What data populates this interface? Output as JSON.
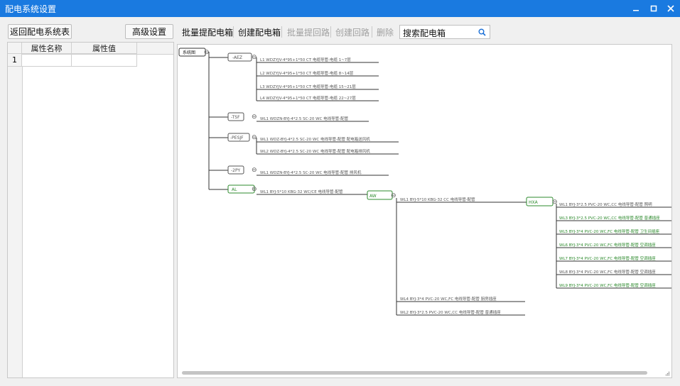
{
  "window": {
    "title": "配电系统设置"
  },
  "left": {
    "back_button": "返回配电系统表",
    "advanced_button": "高级设置",
    "grid": {
      "col1": "属性名称",
      "col2": "属性值",
      "row1_num": "1"
    }
  },
  "toolbar": {
    "batch_extract_box": "批量提配电箱",
    "create_box": "创建配电箱",
    "batch_extract_circuit": "批量提回路",
    "create_circuit": "创建回路",
    "delete": "删除",
    "search_placeholder": "搜索配电箱"
  },
  "tree": {
    "root": "系统图",
    "toggle_glyph": "⊖",
    "g1": {
      "label": "-AEZ",
      "circuits": [
        "L1  WDZYJV-4*95+1*50 CT 电缆导管-电缆  1~7层",
        "L2  WDZYJV-4*95+1*50 CT 电缆导管-电缆  8~14层",
        "L3  WDZYJV-4*95+1*50 CT 电缆导管-电缆  15~21层",
        "L4  WDZYJV-4*95+1*50 CT 电缆导管-电缆  22~27层"
      ]
    },
    "g2": {
      "label": "-TSF",
      "circuits": [
        "WL1  WDZN-BYJ-4*2.5 SC-20 WC 电线导管-配管"
      ]
    },
    "g3": {
      "label": "-PESJF",
      "circuits": [
        "WL1  WDZ-BYJ-4*2.5 SC-20 WC 电线导管-配管 配电箱送风机",
        "WL2  WDZ-BYJ-4*2.5 SC-20 WC 电线导管-配管 配电箱排风机"
      ]
    },
    "g4": {
      "label": "-2PY",
      "circuits": [
        "WL1  WDZN-BYJ-4*2.5 SC-20 WC 电线导管-配管 排风机"
      ]
    },
    "g5": {
      "label": "AL",
      "circuits": [
        "WL1  BYJ-5*10 KBG-32 WC/CE 电线导管-配管"
      ]
    },
    "aw": {
      "label": "AW",
      "circuit": "WL1  BYJ-5*10 KBG-32 CC 电线导管-配管",
      "lower_circuits": [
        "WL4  BYJ-3*4  PVC-20  WC,FC  电线导管-配管  厨房插座",
        "WL2  BYJ-3*2.5  PVC-20  WC,CC  电线导管-配管  普通插座"
      ]
    },
    "hxa": {
      "label": "HXA",
      "circuits": [
        "WL1  BYJ-3*2.5  PVC-20  WC,CC  电线导管-配管  照明",
        "WL3  BYJ-3*2.5  PVC-20  WC,CC  电线导管-配管  普通插座",
        "WL5  BYJ-3*4  PVC-20  WC,FC  电线导管-配管  卫生间插座",
        "WL6  BYJ-3*4  PVC-20  WC,FC  电线导管-配管  空调插座",
        "WL7  BYJ-3*4  PVC-20  WC,FC  电线导管-配管  空调插座",
        "WL8  BYJ-3*4  PVC-20  WC,FC  电线导管-配管  空调插座",
        "WL9  BYJ-3*4  PVC-20  WC,FC  电线导管-配管  空调插座"
      ]
    }
  },
  "colors": {
    "titlebar": "#1a7ae0",
    "green": "#2e8b2e",
    "line": "#333333",
    "gray_text": "#555555"
  }
}
